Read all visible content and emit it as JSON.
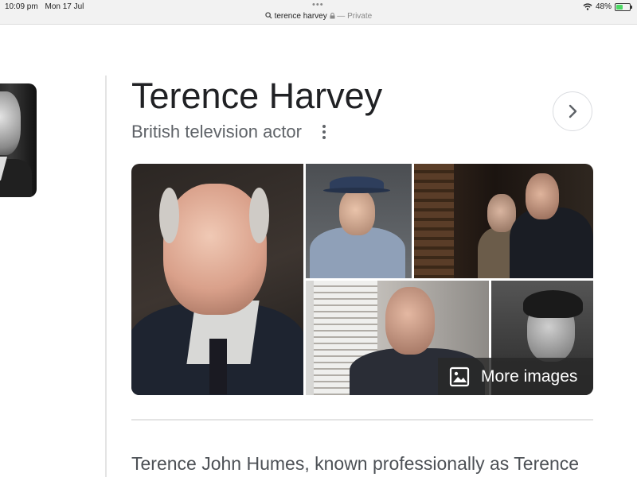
{
  "status_bar": {
    "time": "10:09 pm",
    "date": "Mon 17 Jul",
    "url": "terence harvey",
    "private_label": "— Private",
    "battery_percent": "48%",
    "battery_level": 0.48
  },
  "knowledge_panel": {
    "title": "Terence Harvey",
    "subtitle": "British television actor",
    "more_images_label": "More images",
    "description": "Terence John Humes, known professionally as Terence"
  },
  "colors": {
    "title": "#202124",
    "subtitle": "#5f6368",
    "battery_fill": "#4cd964"
  },
  "icons": {
    "search": "search-icon",
    "lock": "lock-icon",
    "wifi": "wifi-icon",
    "battery": "battery-icon",
    "more_options": "more-vert-icon",
    "next": "chevron-right-icon",
    "images": "image-icon"
  }
}
